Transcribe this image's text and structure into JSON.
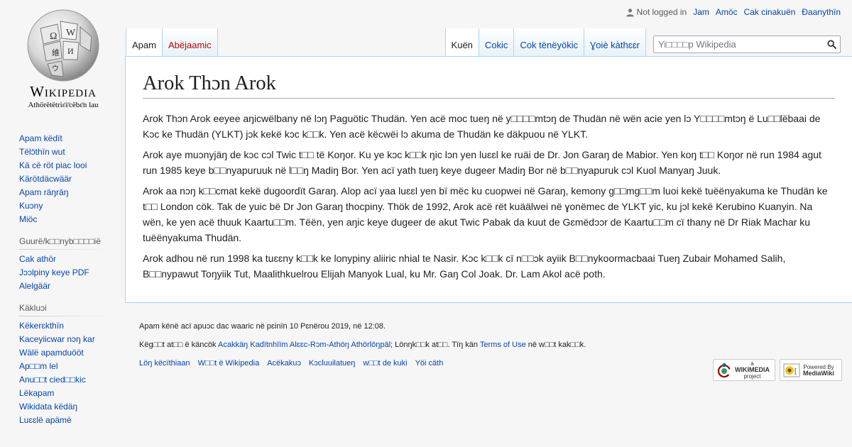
{
  "logo": {
    "wordmark": "Wikipedia",
    "tagline": "Athörëtëtriɛ̈ɛ̈cëbɛ̈n lau"
  },
  "personal": {
    "not_logged_in": "Not logged in",
    "links": [
      "Jam",
      "Amöc",
      "Cak cinakuën",
      "Ɖaanythïn"
    ]
  },
  "tabs_left": [
    {
      "label": "Apam",
      "selected": true
    },
    {
      "label": "Abëjaamic",
      "new": true
    }
  ],
  "tabs_right": [
    {
      "label": "Kuën",
      "selected": true
    },
    {
      "label": "Cokic"
    },
    {
      "label": "Cok tënëyökic"
    },
    {
      "label": "Ɣoiè kàthɛɛr"
    }
  ],
  "search": {
    "placeholder": "Yi□□□□p Wikipedia"
  },
  "page_title": "Arok Thɔn Arok",
  "paragraphs": [
    "Arok Thɔn Arok eeyee aŋicwëlbany në lɔŋ Paguötic Thudän. Yen acë moc tueŋ në y□□□□mtɔŋ de Thudän në wën acie yen lɔ Y□□□□mtɔŋ ë Lu□□lëbaai de Kɔc ke Thudän (YLKT) jɔk kekë kɔc k□□k. Yen acë këcwëi lɔ akuma de Thudän ke däkpuou në YLKT.",
    "Arok aye muɔnyjäŋ de kɔc cɔl Twic t□□ të Koŋor. Ku ye kɔc k□□k ŋic  lɔn  yen luɛɛl ke ruäi de Dr. Jon Garaŋ de Mabior. Yen koŋ t□□ Koŋor në run 1984 agut run 1985 keye b□□nyapuruuk në l□□ŋ Madiŋ Bor. Yen acï yath tueŋ keye dugeer Madiŋ Bor në b□□nyapuruk cɔl Kuol Manyaŋ Juuk.",
    "Arok aa nɔŋ k□□cmat kekë dugoordït Garaŋ. Alop acï yaa luɛɛl yen bï mëc ku cuopwei në Garaŋ, kemony g□□mg□□m luoi kekë tuëënyakuma ke Thudän ke t□□ London cök. Tak de yuic bë Dr Jon Garaŋ thocpiny. Thök de 1992, Arok acë rët kuäälwei në ɣonëmec de YLKT yic, ku jɔl kekë Kerubino Kuanyin. Na wën, ke yen acë thuuk Kaartu□□m. Tëën, yen aŋic keye dugeer de akut Twic Pabak da kuut de Gɛmëdɔɔr de Kaartu□□m cï thany në Dr Riak Machar ku tuëënyakuma Thudän.",
    "Arok adhou në run 1998 ka tuɛɛny k□□k ke lonypiny aliiric nhial te Nasir. Kɔc k□□k cï n□□ɔk ayiik B□□nykoormacbaai Tueŋ Zubair Mohamed Salih, B□□nypawut Toŋyiik Tut, Maalithkuelrou Elijah Manyok Lual, ku Mr. Gaŋ Col Joak. Dr. Lam Akol acë poth."
  ],
  "sidebar": {
    "nav": [
      "Apam këdït",
      "Tëlɔ̈thïn wut",
      "Kä cë röt piac looi",
      "Kärötdäcwäär",
      "Apam räŋräŋ",
      "Kuɔny",
      "Miöc"
    ],
    "tools_heading": "Guurë/k□□nyb□□□□ië",
    "tools": [
      "Cak athör",
      "Jɔɔlpiny keye PDF",
      "Alelgäär"
    ],
    "tools2_heading": "Käkluɔi",
    "tools2": [
      "Këkerɛkthïn",
      "Kaceyiicwar nɔŋ kar",
      "Wälë apamduööt",
      "Ap□□m lel",
      "Anu□□t cied□□kic",
      "Lëkapam",
      "Wikidata këdäŋ",
      "Luɛɛlë apämë"
    ]
  },
  "footer": {
    "last_edited": "Apam kënë acï apuɔc dac waaric në pɛinïn 10 Pɛnërou 2019, në 12:08.",
    "license_pre": "Këg□□t at□□ ë käncök",
    "license_link": "Acakkäŋ Kadïtnhïïm Alɛɛc-Rɔm-Athöŋ Athörlöŋpäl",
    "license_mid": "; Lönŋk□□k at□□. Tïŋ kän",
    "terms_link": "Terms of Use",
    "license_post": "në w□□t kak□□k.",
    "links": [
      "Löŋ këcïthiaan",
      "W□□t ë Wikipedia",
      "Acëkakuɔ",
      "Kɔcluuilatueŋ",
      "w□□t de kuki",
      "Yöi cäth"
    ],
    "badge_wikimedia": [
      "a",
      "WIKIMEDIA",
      "project"
    ],
    "badge_mediawiki": [
      "Powered By",
      "MediaWiki"
    ]
  },
  "colors": {
    "link": "#0645ad",
    "new_link": "#ba0000",
    "border": "#a7d7f9",
    "background": "#f6f6f6"
  }
}
